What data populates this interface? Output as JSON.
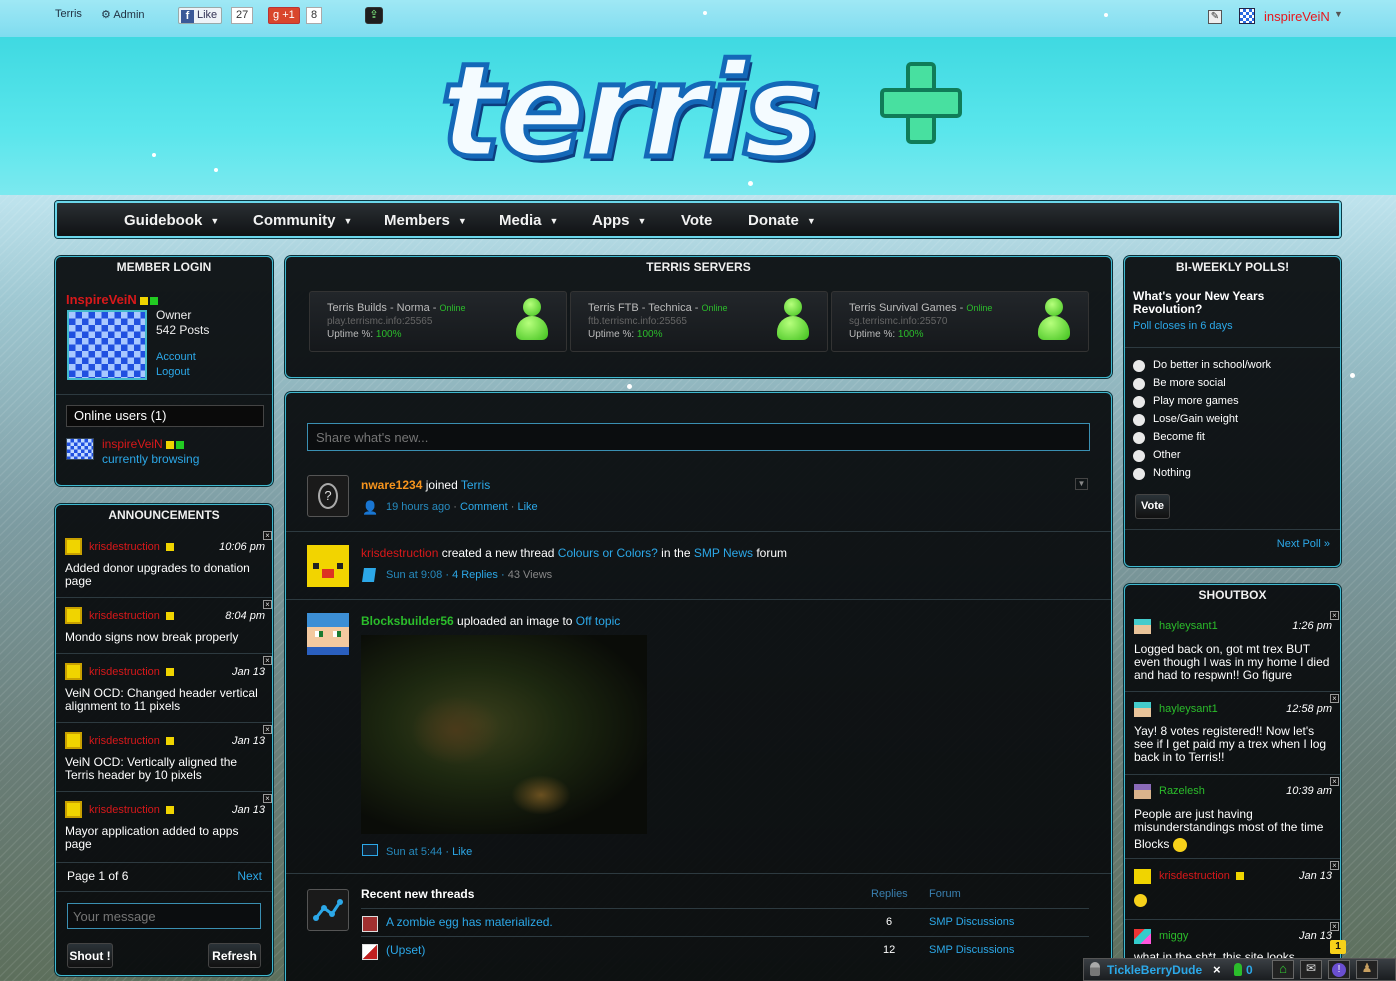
{
  "topbar": {
    "site": "Terris",
    "admin": "Admin",
    "like": "Like",
    "like_count": "27",
    "gplus": "+1",
    "gplus_count": "8",
    "username": "inspireVeiN"
  },
  "logo": {
    "text": "terris"
  },
  "nav": [
    {
      "label": "Guidebook",
      "caret": "▼"
    },
    {
      "label": "Community",
      "caret": "▼"
    },
    {
      "label": "Members",
      "caret": "▼"
    },
    {
      "label": "Media",
      "caret": "▼"
    },
    {
      "label": "Apps",
      "caret": "▼"
    },
    {
      "label": "Vote",
      "caret": ""
    },
    {
      "label": "Donate",
      "caret": "▼"
    }
  ],
  "login": {
    "title": "MEMBER LOGIN",
    "name": "InspireVeiN",
    "role": "Owner",
    "posts": "542 Posts",
    "account": "Account",
    "logout": "Logout",
    "online_title": "Online users (1)",
    "online_name": "inspireVeiN",
    "online_status": "currently browsing"
  },
  "announcements": {
    "title": "ANNOUNCEMENTS",
    "items": [
      {
        "author": "krisdestruction",
        "time": "10:06 pm",
        "text1": "Added donor upgrades to donation",
        "text2": "page"
      },
      {
        "author": "krisdestruction",
        "time": "8:04 pm",
        "text1": "Mondo signs now break properly",
        "text2": ""
      },
      {
        "author": "krisdestruction",
        "time": "Jan 13",
        "text1": "VeiN OCD: Changed header vertical",
        "text2": "alignment to 11 pixels"
      },
      {
        "author": "krisdestruction",
        "time": "Jan 13",
        "text1": "VeiN OCD: Vertically aligned the",
        "text2": "Terris header by 10 pixels"
      },
      {
        "author": "krisdestruction",
        "time": "Jan 13",
        "text1": "Mayor application added to apps",
        "text2": "page"
      }
    ],
    "page": "Page 1 of 6",
    "next": "Next",
    "message_placeholder": "Your message",
    "shout": "Shout !",
    "refresh": "Refresh"
  },
  "servers": {
    "title": "TERRIS SERVERS",
    "items": [
      {
        "name": "Terris Builds - Norma - ",
        "status": "Online",
        "address": "play.terrismc.info:25565",
        "uptime_label": "Uptime %: ",
        "uptime": "100%"
      },
      {
        "name": "Terris FTB - Technica - ",
        "status": "Online",
        "address": "ftb.terrismc.info:25565",
        "uptime_label": "Uptime %: ",
        "uptime": "100%"
      },
      {
        "name": "Terris Survival Games - ",
        "status": "Online",
        "address": "sg.terrismc.info:25570",
        "uptime_label": "Uptime %: ",
        "uptime": "100%"
      }
    ]
  },
  "feed": {
    "share_placeholder": "Share what's new...",
    "item1": {
      "user": "nware1234",
      "action": " joined ",
      "target": "Terris",
      "time": "19 hours ago",
      "comment": "Comment",
      "dot": " · ",
      "like": "Like"
    },
    "item2": {
      "user": "krisdestruction",
      "action": " created a new thread ",
      "thread": "Colours or Colors?",
      "in": " in the ",
      "forum": "SMP News",
      "forum_suffix": " forum",
      "time": "Sun at 9:08",
      "replies": "4 Replies",
      "views": "43 Views"
    },
    "item3": {
      "user": "Blocksbuilder56",
      "action": " uploaded an image to ",
      "target": "Off topic",
      "time": "Sun at 5:44",
      "like": "Like"
    },
    "recent": {
      "title": "Recent new threads",
      "col_replies": "Replies",
      "col_forum": "Forum",
      "rows": [
        {
          "title": "A zombie egg has materialized.",
          "replies": "6",
          "forum": "SMP Discussions"
        },
        {
          "title": "(Upset)",
          "replies": "12",
          "forum": "SMP Discussions"
        }
      ]
    }
  },
  "poll": {
    "title": "BI-WEEKLY POLLS!",
    "question1": "What's your New Years",
    "question2": "Revolution?",
    "closes": "Poll closes in 6 days",
    "options": [
      "Do better in school/work",
      "Be more social",
      "Play more games",
      "Lose/Gain weight",
      "Become fit",
      "Other",
      "Nothing"
    ],
    "vote": "Vote",
    "next": "Next Poll »"
  },
  "shoutbox": {
    "title": "SHOUTBOX",
    "items": [
      {
        "user": "hayleysant1",
        "time": "1:26 pm",
        "l1": "Logged back on, got mt trex BUT",
        "l2": "even though I was in my home I died",
        "l3": "and had to respwn!! Go figure"
      },
      {
        "user": "hayleysant1",
        "time": "12:58 pm",
        "l1": "Yay! 8 votes registered!! Now let's",
        "l2": "see if I get paid my a trex when I log",
        "l3": "back in to Terris!!"
      },
      {
        "user": "Razelesh",
        "time": "10:39 am",
        "l1": "People are just having",
        "l2": "misunderstandings most of the time",
        "l3": "Blocks"
      },
      {
        "user": "krisdestruction",
        "time": "Jan 13",
        "l1": "",
        "l2": "",
        "l3": ""
      },
      {
        "user": "miggy",
        "time": "Jan 13",
        "l1": "what in the sh*t, this site looks",
        "l2": "",
        "l3": ""
      }
    ]
  },
  "chatbar": {
    "user": "TickleBerryDude",
    "close": "×",
    "online": "0",
    "badge": "1"
  },
  "colors": {
    "accent": "#2ca8e8",
    "border": "#3fb8cf",
    "admin_red": "#d8181a",
    "online_green": "#2bbd2b"
  }
}
